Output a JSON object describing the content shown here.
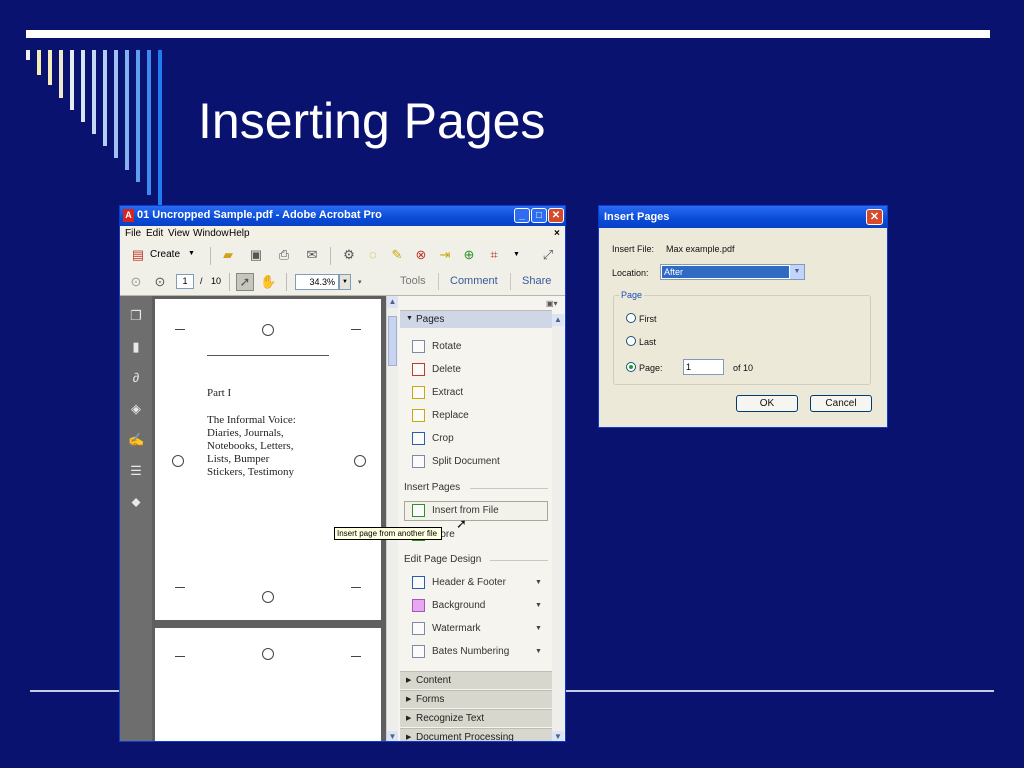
{
  "slide": {
    "title": "Inserting Pages"
  },
  "acrobat": {
    "window_title": "01 Uncropped Sample.pdf - Adobe Acrobat Pro",
    "menu": [
      "File",
      "Edit",
      "View",
      "Window",
      "Help"
    ],
    "menu_close": "×",
    "toolbar": {
      "create_label": "Create"
    },
    "nav": {
      "page_current": "1",
      "page_sep": "/",
      "page_total": "10",
      "zoom": "34.3%"
    },
    "tabs": [
      "Tools",
      "Comment",
      "Share"
    ],
    "document": {
      "part": "Part I",
      "heading_lines": [
        "The Informal Voice:",
        "Diaries, Journals,",
        "Notebooks, Letters,",
        "Lists, Bumper",
        "Stickers, Testimony"
      ]
    },
    "pane": {
      "pages_header": "Pages",
      "pages_items": [
        "Rotate",
        "Delete",
        "Extract",
        "Replace",
        "Crop",
        "Split Document"
      ],
      "insert_header": "Insert Pages",
      "insert_items": [
        "Insert from File",
        "More"
      ],
      "edit_header": "Edit Page Design",
      "edit_items": [
        "Header & Footer",
        "Background",
        "Watermark",
        "Bates Numbering"
      ],
      "collapsed_sections": [
        "Content",
        "Forms",
        "Recognize Text",
        "Document Processing"
      ]
    },
    "tooltip": "Insert page from another file"
  },
  "dialog": {
    "title": "Insert Pages",
    "insert_file_label": "Insert File:",
    "insert_file_value": "Max example.pdf",
    "location_label": "Location:",
    "location_value": "After",
    "group_label": "Page",
    "options": {
      "first": "First",
      "last": "Last",
      "page": "Page:"
    },
    "page_value": "1",
    "of_text": "of 10",
    "ok_label": "OK",
    "cancel_label": "Cancel",
    "close_glyph": "✕"
  },
  "colors": {
    "slide_bg": "#0a1270",
    "xp_title": "#0a4bd6",
    "tab_text": "#3a5a9a"
  }
}
